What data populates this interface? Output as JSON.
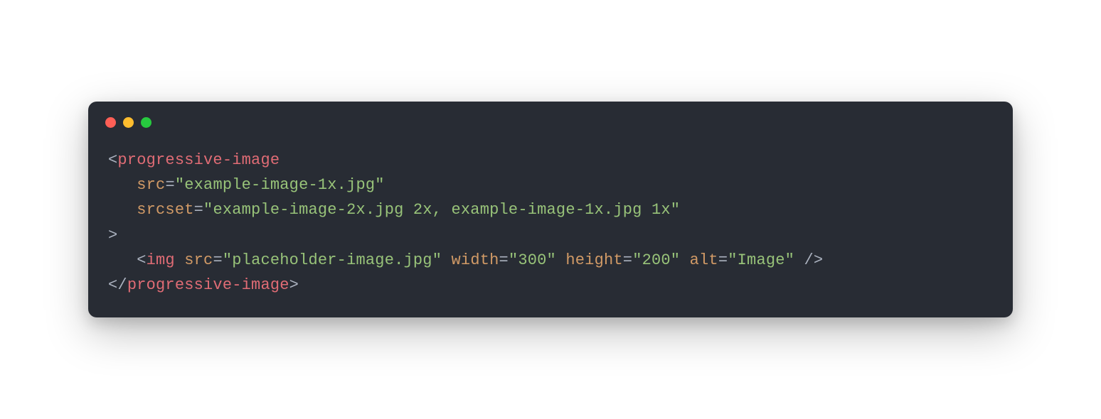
{
  "window": {
    "traffic_light_colors": {
      "red": "#ff5f56",
      "yellow": "#ffbd2e",
      "green": "#27c93f"
    }
  },
  "code": {
    "tokens": [
      [
        {
          "c": "punct",
          "t": "<"
        },
        {
          "c": "tag",
          "t": "progressive-image"
        }
      ],
      [
        {
          "c": "punct",
          "t": "   "
        },
        {
          "c": "attr",
          "t": "src"
        },
        {
          "c": "op",
          "t": "="
        },
        {
          "c": "str",
          "t": "\"example-image-1x.jpg\""
        }
      ],
      [
        {
          "c": "punct",
          "t": "   "
        },
        {
          "c": "attr",
          "t": "srcset"
        },
        {
          "c": "op",
          "t": "="
        },
        {
          "c": "str",
          "t": "\"example-image-2x.jpg 2x, example-image-1x.jpg 1x\""
        }
      ],
      [
        {
          "c": "punct",
          "t": ">"
        }
      ],
      [
        {
          "c": "punct",
          "t": "   <"
        },
        {
          "c": "tag",
          "t": "img"
        },
        {
          "c": "punct",
          "t": " "
        },
        {
          "c": "attr",
          "t": "src"
        },
        {
          "c": "op",
          "t": "="
        },
        {
          "c": "str",
          "t": "\"placeholder-image.jpg\""
        },
        {
          "c": "punct",
          "t": " "
        },
        {
          "c": "attr",
          "t": "width"
        },
        {
          "c": "op",
          "t": "="
        },
        {
          "c": "str",
          "t": "\"300\""
        },
        {
          "c": "punct",
          "t": " "
        },
        {
          "c": "attr",
          "t": "height"
        },
        {
          "c": "op",
          "t": "="
        },
        {
          "c": "str",
          "t": "\"200\""
        },
        {
          "c": "punct",
          "t": " "
        },
        {
          "c": "attr",
          "t": "alt"
        },
        {
          "c": "op",
          "t": "="
        },
        {
          "c": "str",
          "t": "\"Image\""
        },
        {
          "c": "punct",
          "t": " />"
        }
      ],
      [
        {
          "c": "punct",
          "t": "</"
        },
        {
          "c": "tag",
          "t": "progressive-image"
        },
        {
          "c": "punct",
          "t": ">"
        }
      ]
    ]
  }
}
